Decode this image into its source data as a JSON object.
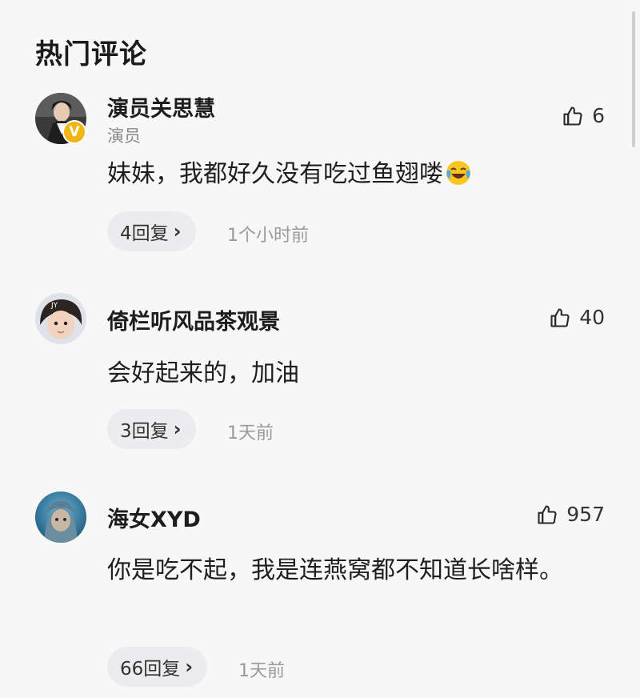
{
  "header": {
    "title": "热门评论"
  },
  "comments": [
    {
      "username": "演员关思慧",
      "role": "演员",
      "verified_badge": "V",
      "likes": "6",
      "text": "妹妹，我都好久没有吃过鱼翅喽",
      "emoji": "crying-laughing-emoji",
      "replies": "4回复",
      "time": "1个小时前"
    },
    {
      "username": "倚栏听风品茶观景",
      "likes": "40",
      "text": "会好起来的，加油",
      "replies": "3回复",
      "time": "1天前"
    },
    {
      "username": "海女XYD",
      "likes": "957",
      "text": "你是吃不起，我是连燕窝都不知道长啥样。",
      "replies": "66回复",
      "time": "1天前"
    }
  ],
  "colors": {
    "background": "#f7f7f8",
    "pill": "#ececee",
    "verified": "#f1b614",
    "muted": "#9a9a9a"
  },
  "icons": [
    "thumbs-up-icon",
    "chevron-right-icon",
    "avatar",
    "verified-badge-icon",
    "crying-laughing-emoji"
  ]
}
